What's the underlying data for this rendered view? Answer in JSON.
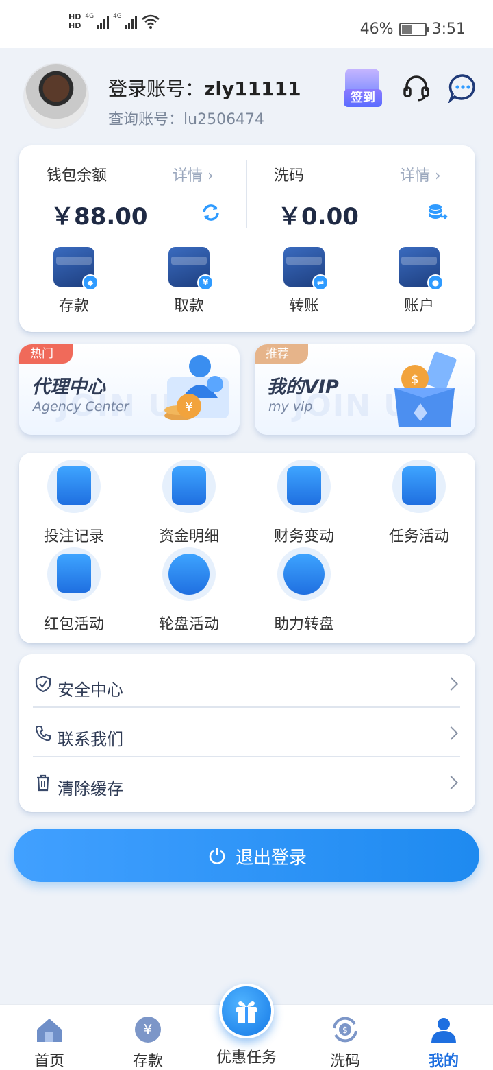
{
  "status_bar": {
    "hd1": "HD",
    "hd2": "HD",
    "net1": "4G",
    "net2": "4G",
    "battery": "46%",
    "battery_level": 0.46,
    "time": "3:51"
  },
  "header": {
    "login_label": "登录账号：",
    "login_value": "zly11111",
    "query_label": "查询账号：",
    "query_value": "lu2506474",
    "signin_label": "签到"
  },
  "wallet": {
    "balance_title": "钱包余额",
    "balance_detail": "详情 ›",
    "balance_amount": "￥88.00",
    "wash_title": "洗码",
    "wash_detail": "详情 ›",
    "wash_amount": "￥0.00",
    "actions": [
      {
        "label": "存款",
        "icon": "deposit-wallet-icon",
        "badge": "◆"
      },
      {
        "label": "取款",
        "icon": "withdraw-card-icon",
        "badge": "¥"
      },
      {
        "label": "转账",
        "icon": "transfer-icon",
        "badge": "⇌"
      },
      {
        "label": "账户",
        "icon": "account-icon",
        "badge": "●"
      }
    ]
  },
  "promos": [
    {
      "tag": "热门",
      "title": "代理中心",
      "subtitle": "Agency Center",
      "bg_text": "JOIN US"
    },
    {
      "tag": "推荐",
      "title": "我的VIP",
      "subtitle": "my vip",
      "bg_text": "JOIN US"
    }
  ],
  "grid": [
    {
      "label": "投注记录"
    },
    {
      "label": "资金明细"
    },
    {
      "label": "财务变动"
    },
    {
      "label": "任务活动"
    },
    {
      "label": "红包活动"
    },
    {
      "label": "轮盘活动"
    },
    {
      "label": "助力转盘"
    }
  ],
  "menu": [
    {
      "label": "安全中心"
    },
    {
      "label": "联系我们"
    },
    {
      "label": "清除缓存"
    }
  ],
  "logout_label": "退出登录",
  "tabs": [
    {
      "label": "首页"
    },
    {
      "label": "存款"
    },
    {
      "label": "优惠任务"
    },
    {
      "label": "洗码"
    },
    {
      "label": "我的"
    }
  ],
  "colors": {
    "accent": "#1e8af0",
    "hot_tag": "#f06a5a",
    "recommend_tag": "#e6b48a"
  }
}
